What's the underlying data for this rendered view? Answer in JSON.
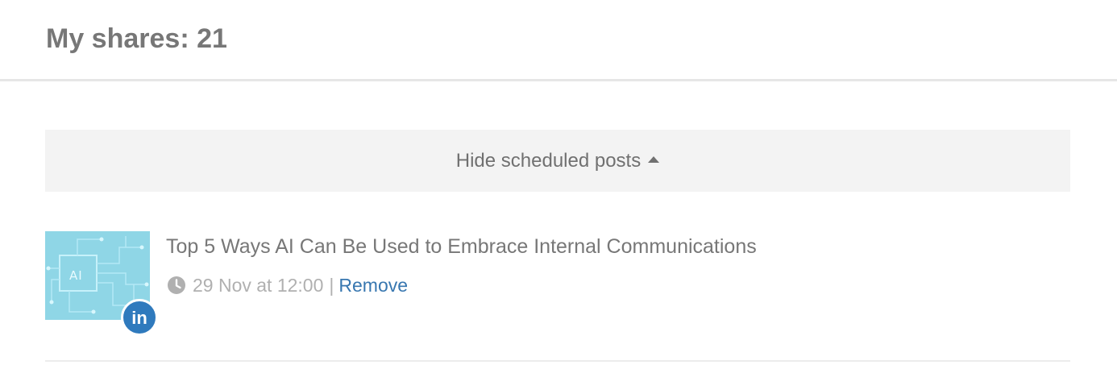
{
  "header": {
    "title": "My shares: 21"
  },
  "scheduled_toggle": {
    "label": "Hide scheduled posts",
    "icon": "caret-up-icon"
  },
  "posts": [
    {
      "title": "Top 5 Ways AI Can Be Used to Embrace Internal Communications",
      "thumbnail_text": "AI",
      "network": "linkedin",
      "network_badge_text": "in",
      "schedule_icon": "clock-icon",
      "scheduled_time": "29 Nov at 12:00",
      "separator": "|",
      "remove_label": "Remove"
    }
  ],
  "colors": {
    "title_text": "#777777",
    "toggle_background": "#f3f3f3",
    "link": "#3877b0",
    "linkedin": "#2f7abd",
    "thumbnail": "#8fd6e6"
  }
}
